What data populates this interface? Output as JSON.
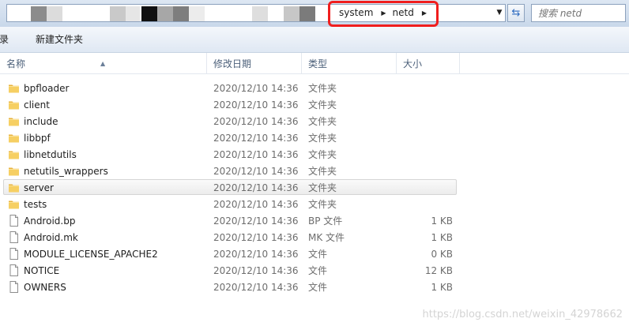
{
  "address_bar": {
    "breadcrumbs": [
      "system",
      "netd"
    ]
  },
  "search": {
    "placeholder": "搜索 netd"
  },
  "toolbar": {
    "left_partial_label": "目录",
    "new_folder_label": "新建文件夹"
  },
  "columns": {
    "name": "名称",
    "date": "修改日期",
    "type": "类型",
    "size": "大小"
  },
  "files": [
    {
      "name": "bpfloader",
      "date": "2020/12/10 14:36",
      "type": "文件夹",
      "size": "",
      "icon": "folder-icon"
    },
    {
      "name": "client",
      "date": "2020/12/10 14:36",
      "type": "文件夹",
      "size": "",
      "icon": "folder-icon"
    },
    {
      "name": "include",
      "date": "2020/12/10 14:36",
      "type": "文件夹",
      "size": "",
      "icon": "folder-icon"
    },
    {
      "name": "libbpf",
      "date": "2020/12/10 14:36",
      "type": "文件夹",
      "size": "",
      "icon": "folder-icon"
    },
    {
      "name": "libnetdutils",
      "date": "2020/12/10 14:36",
      "type": "文件夹",
      "size": "",
      "icon": "folder-icon"
    },
    {
      "name": "netutils_wrappers",
      "date": "2020/12/10 14:36",
      "type": "文件夹",
      "size": "",
      "icon": "folder-icon"
    },
    {
      "name": "server",
      "date": "2020/12/10 14:36",
      "type": "文件夹",
      "size": "",
      "icon": "folder-icon",
      "selected": true
    },
    {
      "name": "tests",
      "date": "2020/12/10 14:36",
      "type": "文件夹",
      "size": "",
      "icon": "folder-icon"
    },
    {
      "name": "Android.bp",
      "date": "2020/12/10 14:36",
      "type": "BP 文件",
      "size": "1 KB",
      "icon": "file-icon"
    },
    {
      "name": "Android.mk",
      "date": "2020/12/10 14:36",
      "type": "MK 文件",
      "size": "1 KB",
      "icon": "file-icon"
    },
    {
      "name": "MODULE_LICENSE_APACHE2",
      "date": "2020/12/10 14:36",
      "type": "文件",
      "size": "0 KB",
      "icon": "file-icon"
    },
    {
      "name": "NOTICE",
      "date": "2020/12/10 14:36",
      "type": "文件",
      "size": "12 KB",
      "icon": "file-icon"
    },
    {
      "name": "OWNERS",
      "date": "2020/12/10 14:36",
      "type": "文件",
      "size": "1 KB",
      "icon": "file-icon"
    }
  ],
  "watermark": "https://blog.csdn.net/weixin_42978662",
  "colors": {
    "highlight_box": "#f01e1e",
    "folder_yellow": "#f2c34f",
    "selected_row": "#ececec"
  }
}
